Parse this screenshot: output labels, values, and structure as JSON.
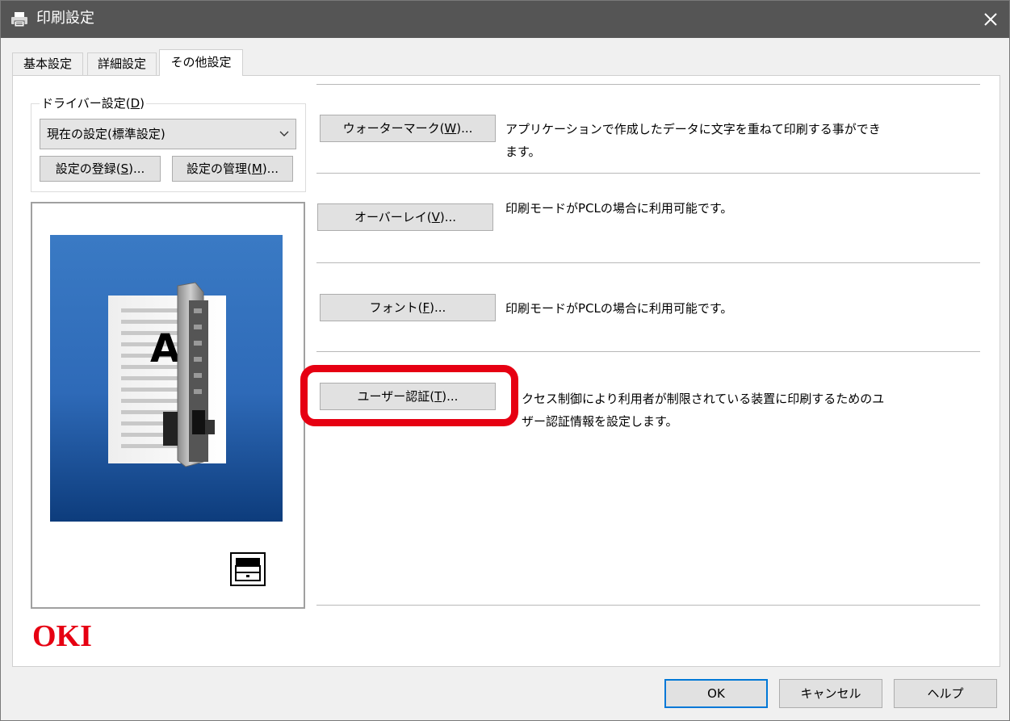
{
  "window": {
    "title": "印刷設定"
  },
  "tabs": [
    {
      "label": "基本設定"
    },
    {
      "label": "詳細設定"
    },
    {
      "label": "その他設定"
    }
  ],
  "driver_settings": {
    "legend_prefix": "ドライバー設定(",
    "legend_key": "D",
    "legend_suffix": ")",
    "selected": "現在の設定(標準設定)",
    "register_prefix": "設定の登録(",
    "register_key": "S",
    "register_suffix": ")...",
    "manage_prefix": "設定の管理(",
    "manage_key": "M",
    "manage_suffix": ")..."
  },
  "logo": {
    "text": "OKI",
    "color": "#e60012"
  },
  "options": [
    {
      "button_prefix": "ウォーターマーク(",
      "button_key": "W",
      "button_suffix": ")...",
      "desc_line1": "アプリケーションで作成したデータに文字を重ねて印刷する事ができ",
      "desc_line2": "ます。"
    },
    {
      "button_prefix": "オーバーレイ(",
      "button_key": "V",
      "button_suffix": ")...",
      "desc_line1": "印刷モードがPCLの場合に利用可能です。"
    },
    {
      "button_prefix": "フォント(",
      "button_key": "F",
      "button_suffix": ")...",
      "desc_line1": "印刷モードがPCLの場合に利用可能です。"
    },
    {
      "button_prefix": "ユーザー認証(",
      "button_key": "T",
      "button_suffix": ")...",
      "desc_line1": "クセス制御により利用者が制限されている装置に印刷するためのユ",
      "desc_line2": "ザー認証情報を設定します。"
    }
  ],
  "footer": {
    "ok": "OK",
    "cancel": "キャンセル",
    "help": "ヘルプ"
  },
  "colors": {
    "titlebar": "#555555",
    "highlight": "#e60012",
    "preview_top": "#3a7ac4",
    "preview_bottom": "#0d3c7c",
    "default_button_border": "#0078d7"
  }
}
